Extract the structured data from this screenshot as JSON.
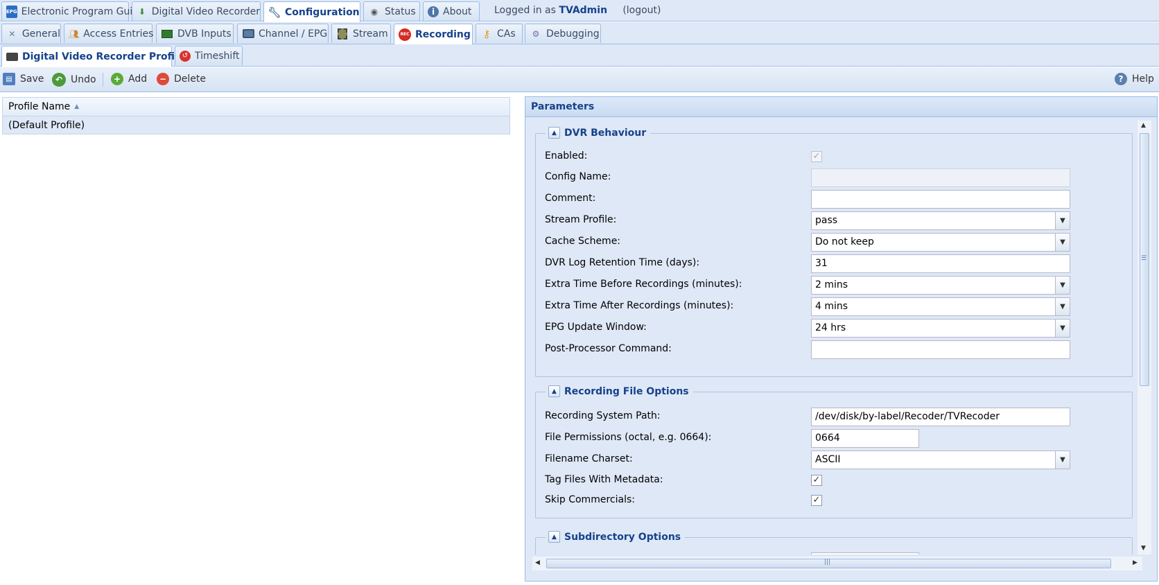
{
  "top_tabs": [
    {
      "label": "Electronic Program Guide",
      "icon": "epg-icon"
    },
    {
      "label": "Digital Video Recorder",
      "icon": "download-icon"
    },
    {
      "label": "Configuration",
      "icon": "wrench-icon",
      "active": true
    },
    {
      "label": "Status",
      "icon": "eye-icon"
    },
    {
      "label": "About",
      "icon": "info-icon"
    }
  ],
  "login": {
    "prefix": "Logged in as",
    "user": "TVAdmin",
    "logout": "(logout)"
  },
  "config_tabs": [
    {
      "label": "General",
      "icon": "tools-icon"
    },
    {
      "label": "Access Entries",
      "icon": "users-icon"
    },
    {
      "label": "DVB Inputs",
      "icon": "card-icon"
    },
    {
      "label": "Channel / EPG",
      "icon": "tv-icon"
    },
    {
      "label": "Stream",
      "icon": "film-icon"
    },
    {
      "label": "Recording",
      "icon": "rec-icon",
      "active": true
    },
    {
      "label": "CAs",
      "icon": "key-icon"
    },
    {
      "label": "Debugging",
      "icon": "bug-icon"
    }
  ],
  "recording_tabs": [
    {
      "label": "Digital Video Recorder Profiles",
      "icon": "recorder-icon",
      "active": true
    },
    {
      "label": "Timeshift",
      "icon": "timeshift-icon"
    }
  ],
  "toolbar": {
    "save": "Save",
    "undo": "Undo",
    "add": "Add",
    "delete": "Delete",
    "help": "Help"
  },
  "grid": {
    "column": "Profile Name",
    "rows": [
      "(Default Profile)"
    ]
  },
  "panel": {
    "title": "Parameters",
    "dvr_behaviour": {
      "legend": "DVR Behaviour",
      "enabled_label": "Enabled:",
      "config_name_label": "Config Name:",
      "config_name_value": "",
      "comment_label": "Comment:",
      "comment_value": "",
      "stream_profile_label": "Stream Profile:",
      "stream_profile_value": "pass",
      "cache_scheme_label": "Cache Scheme:",
      "cache_scheme_value": "Do not keep",
      "log_retention_label": "DVR Log Retention Time (days):",
      "log_retention_value": "31",
      "extra_before_label": "Extra Time Before Recordings (minutes):",
      "extra_before_value": "2 mins",
      "extra_after_label": "Extra Time After Recordings (minutes):",
      "extra_after_value": "4 mins",
      "epg_window_label": "EPG Update Window:",
      "epg_window_value": "24 hrs",
      "post_processor_label": "Post-Processor Command:",
      "post_processor_value": ""
    },
    "file_options": {
      "legend": "Recording File Options",
      "path_label": "Recording System Path:",
      "path_value": "/dev/disk/by-label/Recoder/TVRecoder",
      "perm_label": "File Permissions (octal, e.g. 0664):",
      "perm_value": "0664",
      "charset_label": "Filename Charset:",
      "charset_value": "ASCII",
      "tag_label": "Tag Files With Metadata:",
      "skip_label": "Skip Commercials:"
    },
    "subdir_options": {
      "legend": "Subdirectory Options"
    }
  }
}
